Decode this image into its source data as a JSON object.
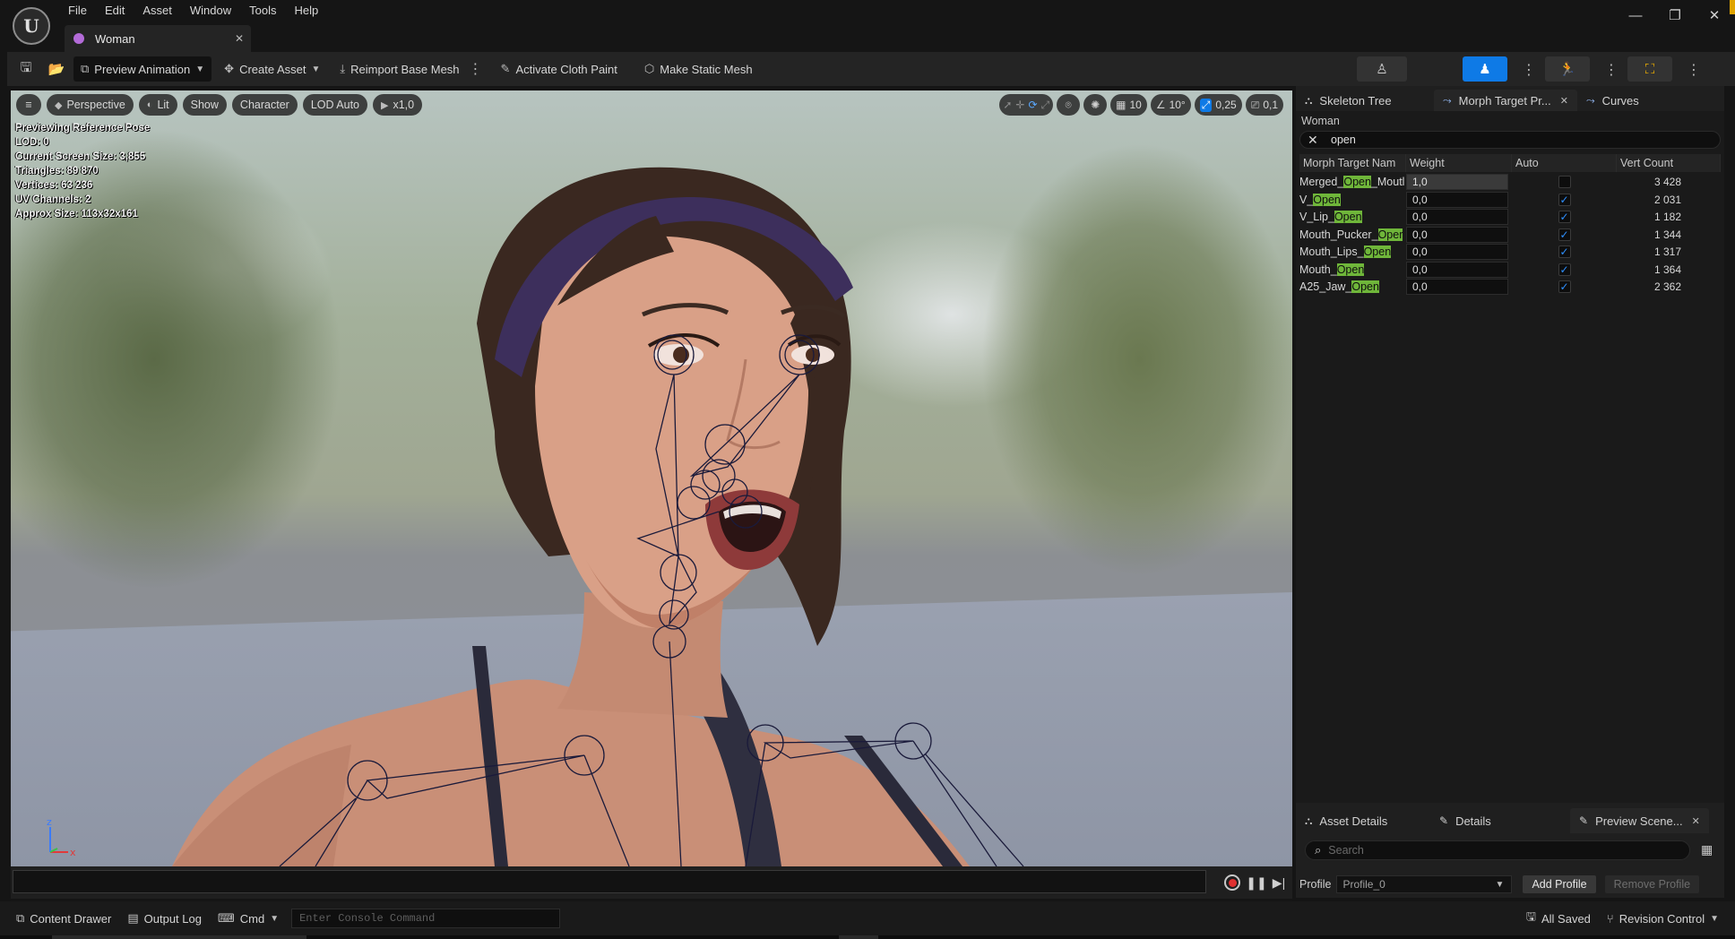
{
  "app": {
    "logo_text": "U",
    "menu": [
      "File",
      "Edit",
      "Asset",
      "Window",
      "Tools",
      "Help"
    ],
    "document_tab": "Woman",
    "window_controls": [
      "minimize-icon",
      "restore-icon",
      "close-icon"
    ]
  },
  "toolbar": {
    "save_icon": "save-icon",
    "browse_icon": "browse-asset-icon",
    "preview_animation": "Preview Animation",
    "create_asset": "Create Asset",
    "reimport": "Reimport Base Mesh",
    "cloth_paint": "Activate Cloth Paint",
    "static_mesh": "Make Static Mesh",
    "mode_buttons": [
      "skeleton-mode",
      "mesh-mode",
      "animation-mode",
      "physics-mode"
    ]
  },
  "viewport": {
    "buttons": {
      "menu": "≡",
      "perspective": "Perspective",
      "lit": "Lit",
      "show": "Show",
      "character": "Character",
      "lod": "LOD Auto",
      "speed": "x1,0"
    },
    "tools": {
      "grid_snap": "10",
      "rotation_snap": "10°",
      "scale_snap": "0,25",
      "camera_speed": "0,1"
    },
    "stats": [
      "Previewing Reference Pose",
      "LOD: 0",
      "Current Screen Size: 3,855",
      "Triangles: 89 870",
      "Vertices: 63 236",
      "UV Channels: 2",
      "Approx Size: 113x32x161"
    ],
    "axis": {
      "z": "z",
      "x": "x"
    }
  },
  "right_panel": {
    "tabs": [
      {
        "label": "Skeleton Tree",
        "icon": "skeleton-tree-icon"
      },
      {
        "label": "Morph Target Pr...",
        "icon": "morph-target-icon",
        "closable": true
      },
      {
        "label": "Curves",
        "icon": "curves-icon"
      }
    ],
    "asset_name": "Woman",
    "filter": "open",
    "columns": [
      "Morph Target Nam",
      "Weight",
      "Auto",
      "Vert Count"
    ],
    "rows": [
      {
        "pre": "Merged_",
        "hl": "Open",
        "post": "_Moutl",
        "weight": "1,0",
        "weight_fill": 1.0,
        "auto": false,
        "verts": "3 428"
      },
      {
        "pre": "V_",
        "hl": "Open",
        "post": "",
        "weight": "0,0",
        "weight_fill": 0.0,
        "auto": true,
        "verts": "2 031"
      },
      {
        "pre": "V_Lip_",
        "hl": "Open",
        "post": "",
        "weight": "0,0",
        "weight_fill": 0.0,
        "auto": true,
        "verts": "1 182"
      },
      {
        "pre": "Mouth_Pucker_",
        "hl": "Oper",
        "post": "",
        "weight": "0,0",
        "weight_fill": 0.0,
        "auto": true,
        "verts": "1 344"
      },
      {
        "pre": "Mouth_Lips_",
        "hl": "Open",
        "post": "",
        "weight": "0,0",
        "weight_fill": 0.0,
        "auto": true,
        "verts": "1 317"
      },
      {
        "pre": "Mouth_",
        "hl": "Open",
        "post": "",
        "weight": "0,0",
        "weight_fill": 0.0,
        "auto": true,
        "verts": "1 364"
      },
      {
        "pre": "A25_Jaw_",
        "hl": "Open",
        "post": "",
        "weight": "0,0",
        "weight_fill": 0.0,
        "auto": true,
        "verts": "2 362"
      }
    ],
    "bottom_tabs": [
      "Asset Details",
      "Details",
      "Preview Scene..."
    ],
    "search_placeholder": "Search",
    "profile_label": "Profile",
    "profile_value": "Profile_0",
    "add_profile": "Add Profile",
    "remove_profile": "Remove Profile"
  },
  "statusbar": {
    "content_drawer": "Content Drawer",
    "output_log": "Output Log",
    "cmd": "Cmd",
    "console_placeholder": "Enter Console Command",
    "all_saved": "All Saved",
    "revision_control": "Revision Control"
  },
  "colors": {
    "accent_blue": "#0e7ae6",
    "highlight_green": "#6fb63a",
    "panel_bg": "#1f1f1f"
  }
}
